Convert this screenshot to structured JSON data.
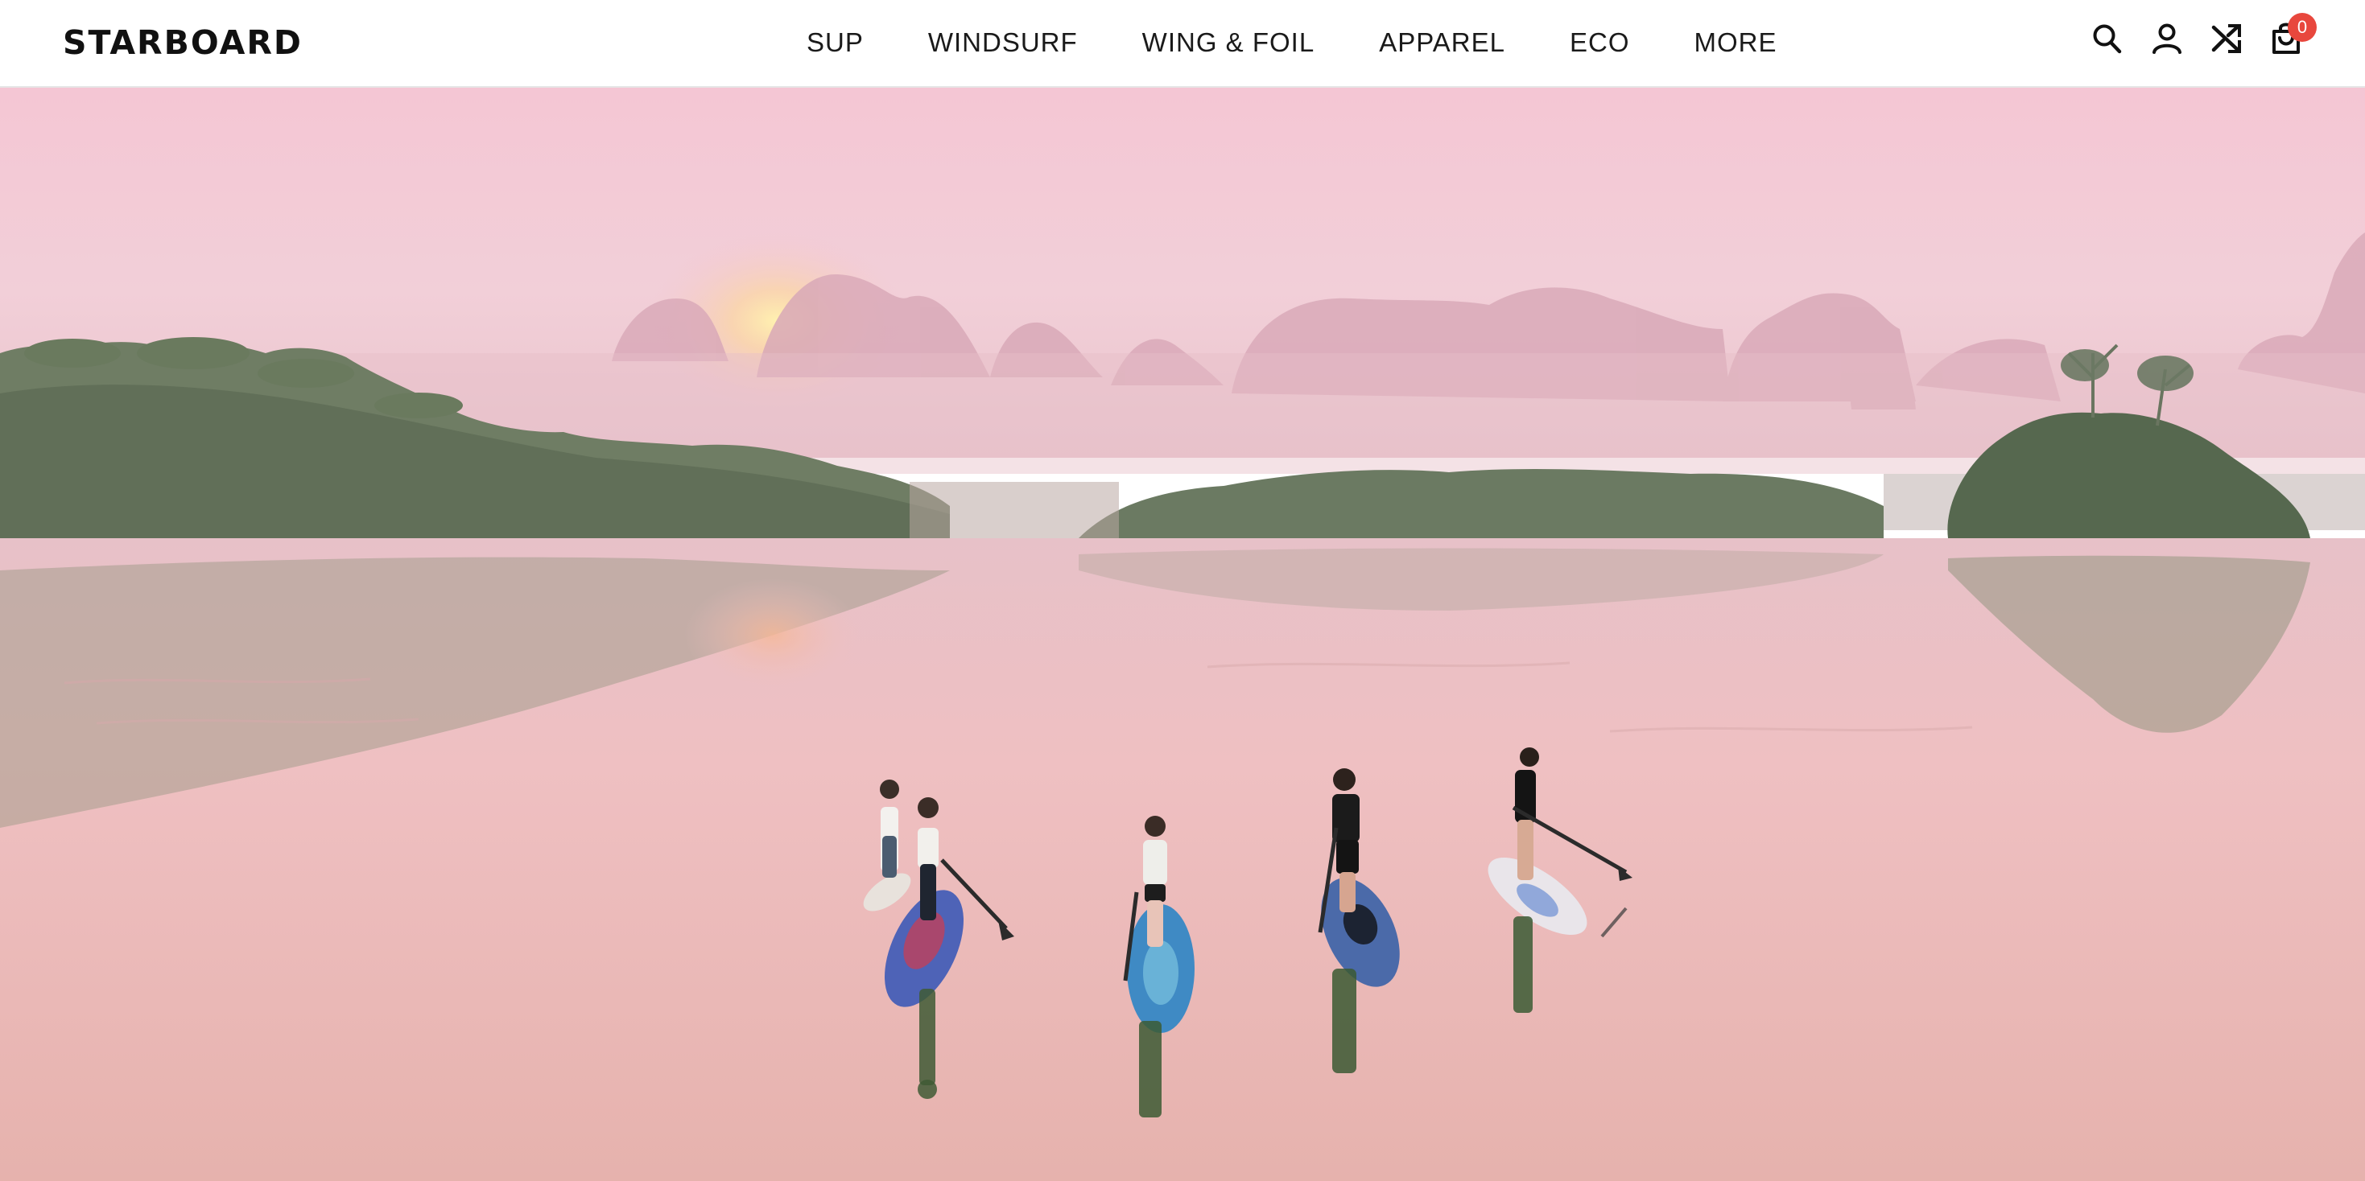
{
  "brand": {
    "logo_text": "STARBOARD"
  },
  "nav": {
    "items": [
      {
        "label": "SUP"
      },
      {
        "label": "WINDSURF"
      },
      {
        "label": "WING & FOIL"
      },
      {
        "label": "APPAREL"
      },
      {
        "label": "ECO"
      },
      {
        "label": "MORE"
      }
    ]
  },
  "header_icons": {
    "search": "search-icon",
    "account": "user-icon",
    "compare": "shuffle-icon",
    "cart": "cart-icon",
    "cart_count": "0"
  },
  "colors": {
    "badge": "#e8473d",
    "sky_top": "#f3c2cf",
    "water": "#e9b8b8"
  }
}
